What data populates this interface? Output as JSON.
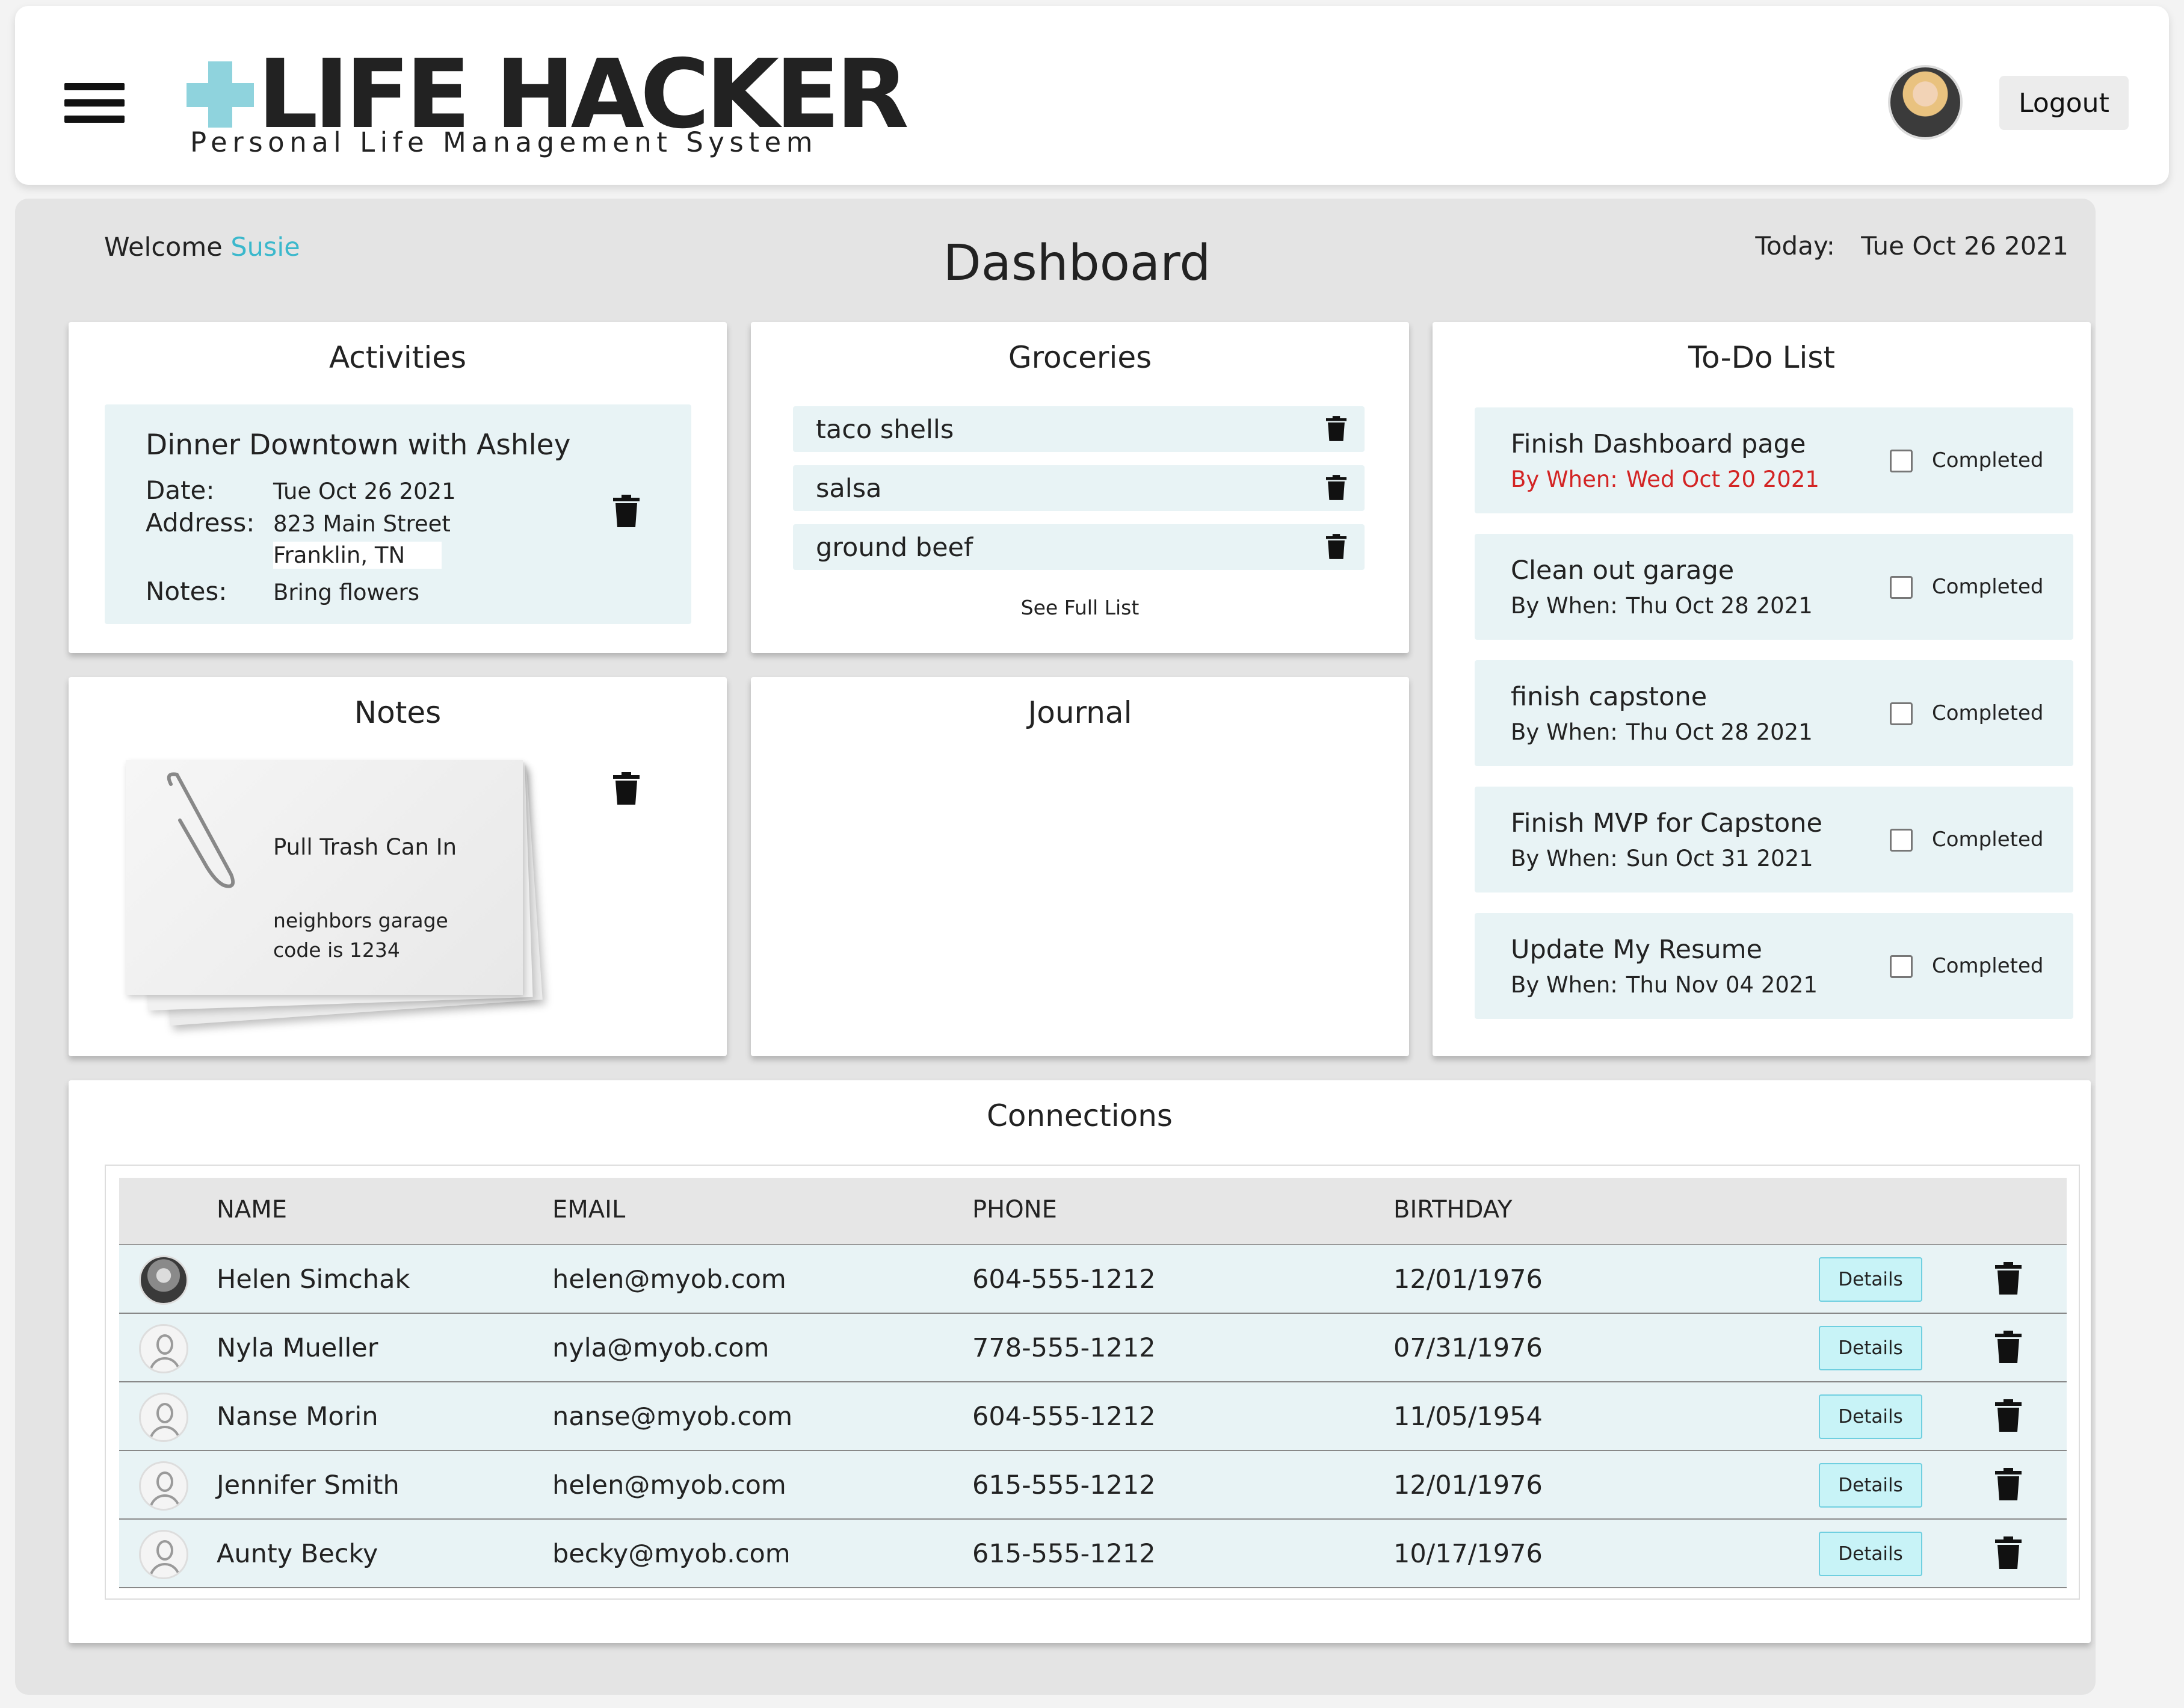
{
  "header": {
    "logo_title": "LIFE HACKER",
    "logo_subtitle": "Personal Life Management System",
    "logout_label": "Logout"
  },
  "welcome": {
    "prefix": "Welcome",
    "name": "Susie"
  },
  "page_title": "Dashboard",
  "today": {
    "label": "Today:",
    "value": "Tue Oct 26 2021"
  },
  "activities": {
    "title": "Activities",
    "item": {
      "name": "Dinner Downtown with Ashley",
      "date_label": "Date:",
      "date": "Tue Oct 26 2021",
      "address_label": "Address:",
      "address_line1": "823 Main Street",
      "address_line2": "Franklin, TN",
      "notes_label": "Notes:",
      "notes": "Bring flowers"
    }
  },
  "groceries": {
    "title": "Groceries",
    "items": [
      "taco shells",
      "salsa",
      "ground beef"
    ],
    "see_full": "See Full List"
  },
  "todo": {
    "title": "To-Do List",
    "by_when_label": "By When:",
    "completed_label": "Completed",
    "items": [
      {
        "title": "Finish Dashboard page",
        "when": "Wed Oct 20 2021",
        "overdue": true
      },
      {
        "title": "Clean out garage",
        "when": "Thu Oct 28 2021",
        "overdue": false
      },
      {
        "title": "finish capstone",
        "when": "Thu Oct 28 2021",
        "overdue": false
      },
      {
        "title": "Finish MVP for Capstone",
        "when": "Sun Oct 31 2021",
        "overdue": false
      },
      {
        "title": "Update My Resume",
        "when": "Thu Nov 04 2021",
        "overdue": false
      }
    ],
    "colors": {
      "overdue": "#d32424"
    }
  },
  "notes": {
    "title": "Notes",
    "item": {
      "title": "Pull Trash Can In",
      "body": "neighbors garage code is 1234"
    }
  },
  "journal": {
    "title": "Journal"
  },
  "connections": {
    "title": "Connections",
    "columns": [
      "NAME",
      "EMAIL",
      "PHONE",
      "BIRTHDAY"
    ],
    "details_label": "Details",
    "rows": [
      {
        "name": "Helen Simchak",
        "email": "helen@myob.com",
        "phone": "604-555-1212",
        "birthday": "12/01/1976",
        "photo": true
      },
      {
        "name": "Nyla Mueller",
        "email": "nyla@myob.com",
        "phone": "778-555-1212",
        "birthday": "07/31/1976",
        "photo": false
      },
      {
        "name": "Nanse Morin",
        "email": "nanse@myob.com",
        "phone": "604-555-1212",
        "birthday": "11/05/1954",
        "photo": false
      },
      {
        "name": "Jennifer Smith",
        "email": "helen@myob.com",
        "phone": "615-555-1212",
        "birthday": "12/01/1976",
        "photo": false
      },
      {
        "name": "Aunty Becky",
        "email": "becky@myob.com",
        "phone": "615-555-1212",
        "birthday": "10/17/1976",
        "photo": false
      }
    ]
  },
  "colors": {
    "accent": "#3bb8cc",
    "item_bg": "#e8f3f5",
    "logo_cross": "#8fd3dd"
  },
  "icons": {
    "menu": "hamburger-icon",
    "trash": "trash-icon",
    "avatar": "user-avatar-icon"
  }
}
